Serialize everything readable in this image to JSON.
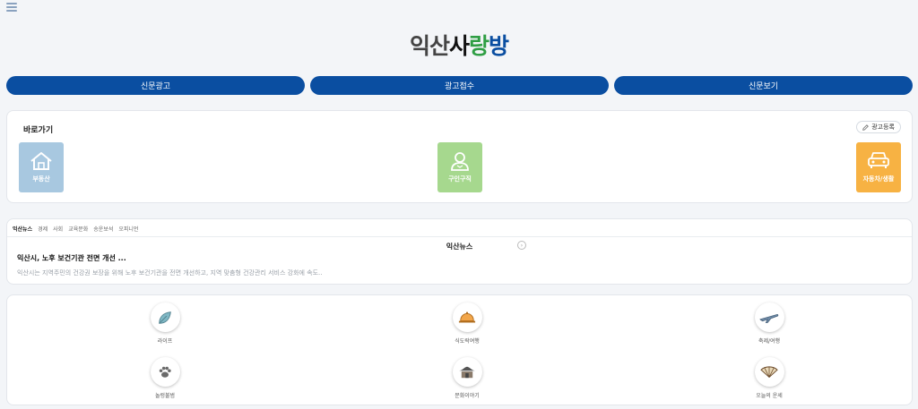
{
  "header": {
    "menu_icon": "hamburger-menu-icon",
    "logo": {
      "part1": "익산",
      "part2": "사",
      "part3": "랑",
      "part4": "방"
    }
  },
  "topnav": {
    "items": [
      "신문광고",
      "광고접수",
      "신문보기"
    ]
  },
  "shortcuts": {
    "title": "바로가기",
    "register_label": "광고등록",
    "tiles": [
      {
        "label": "부동산",
        "icon": "house-icon",
        "color": "#a8c8e0"
      },
      {
        "label": "구인구직",
        "icon": "person-icon",
        "color": "#a6d88e"
      },
      {
        "label": "자동차/생활",
        "icon": "car-icon",
        "color": "#f7b243"
      }
    ]
  },
  "news": {
    "tabs": [
      "익산뉴스",
      "경제",
      "사회",
      "교육문화",
      "송운보석",
      "오피니언"
    ],
    "section_title": "익산뉴스",
    "headline": "익산시, 노후 보건기관 전면 개선 ...",
    "summary": "익산시는 지역주민의 건강권 보장을 위해 노후 보건기관을 전면 개선하고, 지역 맞춤형 건강관리 서비스 강화에 속도.."
  },
  "menu": {
    "items": [
      {
        "label": "라이프",
        "icon": "leaf-icon"
      },
      {
        "label": "식도락여행",
        "icon": "food-dish-icon"
      },
      {
        "label": "축제/여행",
        "icon": "airplane-icon"
      },
      {
        "label": "놀렁불범",
        "icon": "paw-icon"
      },
      {
        "label": "문화이야기",
        "icon": "hanok-icon"
      },
      {
        "label": "오늘의 운세",
        "icon": "fan-icon"
      }
    ]
  },
  "colors": {
    "primary": "#0a4ea1",
    "background": "#f3f5f8"
  }
}
